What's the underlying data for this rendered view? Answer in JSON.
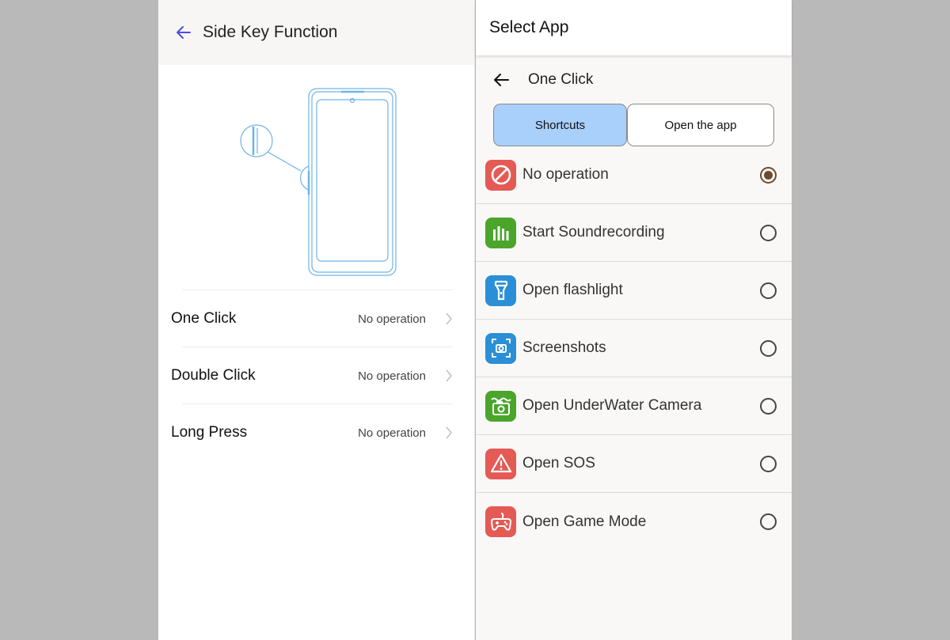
{
  "left_panel": {
    "title": "Side Key Function",
    "settings": [
      {
        "label": "One Click",
        "value": "No operation"
      },
      {
        "label": "Double Click",
        "value": "No operation"
      },
      {
        "label": "Long Press",
        "value": "No operation"
      }
    ]
  },
  "right_panel": {
    "title": "Select App",
    "sub_title": "One Click",
    "tabs": [
      {
        "label": "Shortcuts",
        "active": true
      },
      {
        "label": "Open the app",
        "active": false
      }
    ],
    "options": [
      {
        "label": "No operation",
        "icon": "no-entry-icon",
        "color": "#e45a55",
        "selected": true
      },
      {
        "label": "Start Soundrecording",
        "icon": "soundwave-icon",
        "color": "#4aa52a",
        "selected": false
      },
      {
        "label": "Open flashlight",
        "icon": "flashlight-icon",
        "color": "#2a8fd6",
        "selected": false
      },
      {
        "label": "Screenshots",
        "icon": "screenshot-icon",
        "color": "#2a8fd6",
        "selected": false
      },
      {
        "label": "Open UnderWater Camera",
        "icon": "underwater-camera-icon",
        "color": "#4aa52a",
        "selected": false
      },
      {
        "label": "Open SOS",
        "icon": "sos-warning-icon",
        "color": "#e45a55",
        "selected": false
      },
      {
        "label": "Open Game Mode",
        "icon": "gamepad-icon",
        "color": "#e45a55",
        "selected": false
      }
    ]
  },
  "colors": {
    "accent_blue": "#4a4ee0",
    "tab_active": "#a9cffb",
    "radio_selected": "#6e4a2b"
  }
}
